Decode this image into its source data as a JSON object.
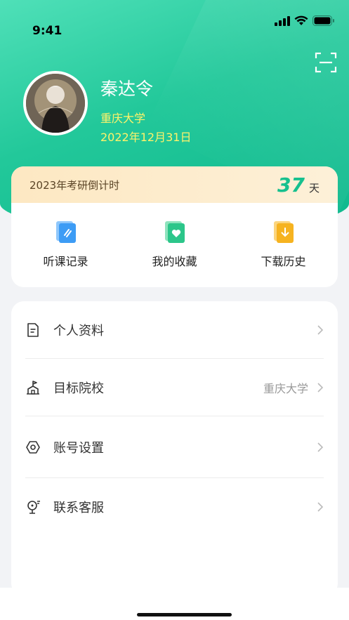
{
  "status_bar": {
    "time": "9:41"
  },
  "profile": {
    "name": "秦达令",
    "school": "重庆大学",
    "date": "2022年12月31日"
  },
  "countdown": {
    "label": "2023年考研倒计时",
    "days": "37",
    "unit": "天"
  },
  "quick_actions": [
    {
      "label": "听课记录",
      "icon": "lecture-record-icon",
      "color": "#3d9cf5"
    },
    {
      "label": "我的收藏",
      "icon": "favorites-icon",
      "color": "#2cc68a"
    },
    {
      "label": "下载历史",
      "icon": "download-history-icon",
      "color": "#f6b320"
    }
  ],
  "menu": [
    {
      "label": "个人资料",
      "value": "",
      "icon": "profile-document-icon"
    },
    {
      "label": "目标院校",
      "value": "重庆大学",
      "icon": "target-school-icon"
    },
    {
      "label": "账号设置",
      "value": "",
      "icon": "settings-icon"
    },
    {
      "label": "联系客服",
      "value": "",
      "icon": "customer-service-icon"
    }
  ],
  "colors": {
    "accent": "#16c08e",
    "profile_text": "#fff36a",
    "countdown_bg": "#fde8c2"
  }
}
